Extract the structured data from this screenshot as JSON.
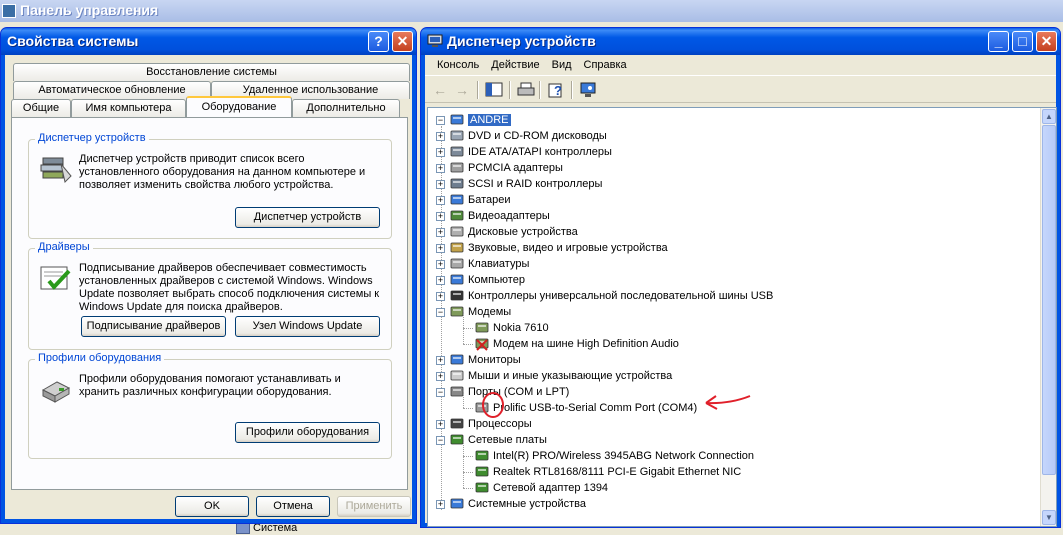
{
  "control_panel": {
    "title": "Панель управления",
    "status_item": "Система"
  },
  "system_properties": {
    "title": "Свойства системы",
    "tabs_row1": [
      "Восстановление системы"
    ],
    "tabs_row2": [
      "Автоматическое обновление",
      "Удаленное использование"
    ],
    "tabs_row3": [
      "Общие",
      "Имя компьютера",
      "Оборудование",
      "Дополнительно"
    ],
    "active_tab": "Оборудование",
    "groups": {
      "device_manager": {
        "title": "Диспетчер устройств",
        "text": "Диспетчер устройств приводит список всего установленного оборудования на данном компьютере и позволяет изменить свойства любого устройства.",
        "button": "Диспетчер устройств"
      },
      "drivers": {
        "title": "Драйверы",
        "text": "Подписывание драйверов обеспечивает совместимость установленных драйверов с системой Windows.  Windows Update позволяет выбрать способ подключения системы к Windows Update для поиска драйверов.",
        "button_signing": "Подписывание драйверов",
        "button_update": "Узел Windows Update"
      },
      "profiles": {
        "title": "Профили оборудования",
        "text": "Профили оборудования помогают устанавливать и хранить различных конфигурации оборудования.",
        "button": "Профили оборудования"
      }
    },
    "buttons": {
      "ok": "OK",
      "cancel": "Отмена",
      "apply": "Применить"
    }
  },
  "device_manager": {
    "title": "Диспетчер устройств",
    "menu": [
      "Консоль",
      "Действие",
      "Вид",
      "Справка"
    ],
    "tree": {
      "root": "ANDRE",
      "items": [
        {
          "label": "DVD и CD-ROM дисководы",
          "icon": "cdrom-icon"
        },
        {
          "label": "IDE ATA/ATAPI контроллеры",
          "icon": "ide-icon"
        },
        {
          "label": "PCMCIA адаптеры",
          "icon": "pcmcia-icon"
        },
        {
          "label": "SCSI и RAID контроллеры",
          "icon": "scsi-icon"
        },
        {
          "label": "Батареи",
          "icon": "battery-icon"
        },
        {
          "label": "Видеоадаптеры",
          "icon": "display-adapter-icon"
        },
        {
          "label": "Дисковые устройства",
          "icon": "disk-icon"
        },
        {
          "label": "Звуковые, видео и игровые устройства",
          "icon": "sound-icon"
        },
        {
          "label": "Клавиатуры",
          "icon": "keyboard-icon"
        },
        {
          "label": "Компьютер",
          "icon": "computer-icon"
        },
        {
          "label": "Контроллеры универсальной последовательной шины USB",
          "icon": "usb-icon"
        },
        {
          "label": "Модемы",
          "icon": "modem-icon",
          "expanded": true
        },
        {
          "label": "Nokia 7610",
          "icon": "modem-icon",
          "child": true
        },
        {
          "label": "Модем на шине High Definition Audio",
          "icon": "modem-disabled-icon",
          "child": true
        },
        {
          "label": "Мониторы",
          "icon": "monitor-icon"
        },
        {
          "label": "Мыши и иные указывающие устройства",
          "icon": "mouse-icon"
        },
        {
          "label": "Порты (COM и LPT)",
          "icon": "port-icon",
          "expanded": true
        },
        {
          "label": "Prolific USB-to-Serial Comm Port (COM4)",
          "icon": "serial-port-icon",
          "child": true
        },
        {
          "label": "Процессоры",
          "icon": "processor-icon"
        },
        {
          "label": "Сетевые платы",
          "icon": "network-icon",
          "expanded": true
        },
        {
          "label": "Intel(R) PRO/Wireless 3945ABG Network Connection",
          "icon": "network-icon",
          "child": true
        },
        {
          "label": "Realtek RTL8168/8111 PCI-E Gigabit Ethernet NIC",
          "icon": "network-icon",
          "child": true
        },
        {
          "label": "Сетевой адаптер 1394",
          "icon": "network-icon",
          "child": true
        },
        {
          "label": "Системные устройства",
          "icon": "system-icon"
        }
      ]
    }
  },
  "colors": {
    "xp_blue": "#0054e3",
    "annotation_red": "#e0202a",
    "selection": "#316ac5"
  }
}
